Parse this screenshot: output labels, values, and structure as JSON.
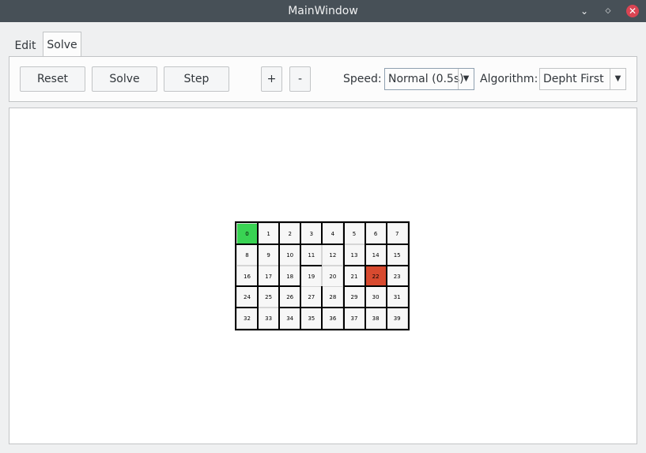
{
  "window": {
    "title": "MainWindow"
  },
  "tabs": [
    {
      "label": "Edit"
    },
    {
      "label": "Solve",
      "active": true
    }
  ],
  "toolbar": {
    "reset_label": "Reset",
    "solve_label": "Solve",
    "step_label": "Step",
    "plus_label": "+",
    "minus_label": "-",
    "speed_label": "Speed:",
    "speed_value": "Normal (0.5s)",
    "algorithm_label": "Algorithm:",
    "algorithm_value": "Depht First"
  },
  "maze": {
    "cols": 8,
    "rows": 5,
    "start_cell": 0,
    "goal_cell": 22,
    "start_color": "#39d353",
    "goal_color": "#d84a2f",
    "cells": [
      "0",
      "1",
      "2",
      "3",
      "4",
      "5",
      "6",
      "7",
      "8",
      "9",
      "10",
      "11",
      "12",
      "13",
      "14",
      "15",
      "16",
      "17",
      "18",
      "19",
      "20",
      "21",
      "22",
      "23",
      "24",
      "25",
      "26",
      "27",
      "28",
      "29",
      "30",
      "31",
      "32",
      "33",
      "34",
      "35",
      "36",
      "37",
      "38",
      "39"
    ]
  }
}
